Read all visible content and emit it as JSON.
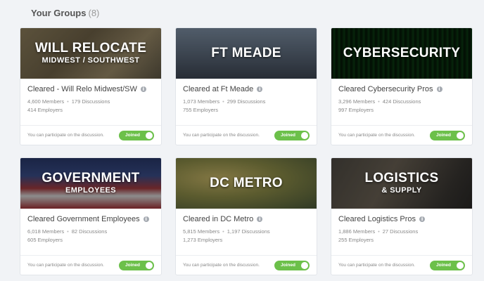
{
  "header": {
    "title": "Your Groups",
    "count": "(8)"
  },
  "cards": [
    {
      "banner_line1": "WILL RELOCATE",
      "banner_line2": "MIDWEST / SOUTHWEST",
      "title": "Cleared - Will Relo Midwest/SW",
      "members": "4,600 Members",
      "discussions": "179 Discussions",
      "employers": "414 Employers",
      "note": "You can participate on the discussion.",
      "toggle": "Joined"
    },
    {
      "banner_line1": "FT MEADE",
      "banner_line2": "",
      "title": "Cleared at Ft Meade",
      "members": "1,073 Members",
      "discussions": "299 Discussions",
      "employers": "755 Employers",
      "note": "You can participate on the discussion.",
      "toggle": "Joined"
    },
    {
      "banner_line1": "CYBERSECURITY",
      "banner_line2": "",
      "title": "Cleared Cybersecurity Pros",
      "members": "3,296 Members",
      "discussions": "424 Discussions",
      "employers": "997 Employers",
      "note": "You can participate on the discussion.",
      "toggle": "Joined"
    },
    {
      "banner_line1": "GOVERNMENT",
      "banner_line2": "EMPLOYEES",
      "title": "Cleared Government Employees",
      "members": "6,018 Members",
      "discussions": "82 Discussions",
      "employers": "605 Employers",
      "note": "You can participate on the discussion.",
      "toggle": "Joined"
    },
    {
      "banner_line1": "DC METRO",
      "banner_line2": "",
      "title": "Cleared in DC Metro",
      "members": "5,815 Members",
      "discussions": "1,197 Discussions",
      "employers": "1,273 Employers",
      "note": "You can participate on the discussion.",
      "toggle": "Joined"
    },
    {
      "banner_line1": "LOGISTICS",
      "banner_line2": "& SUPPLY",
      "title": "Cleared Logistics Pros",
      "members": "1,886 Members",
      "discussions": "27 Discussions",
      "employers": "255 Employers",
      "note": "You can participate on the discussion.",
      "toggle": "Joined"
    }
  ],
  "colors": {
    "toggle_on": "#6cc04a",
    "background": "#f1f3f6"
  }
}
